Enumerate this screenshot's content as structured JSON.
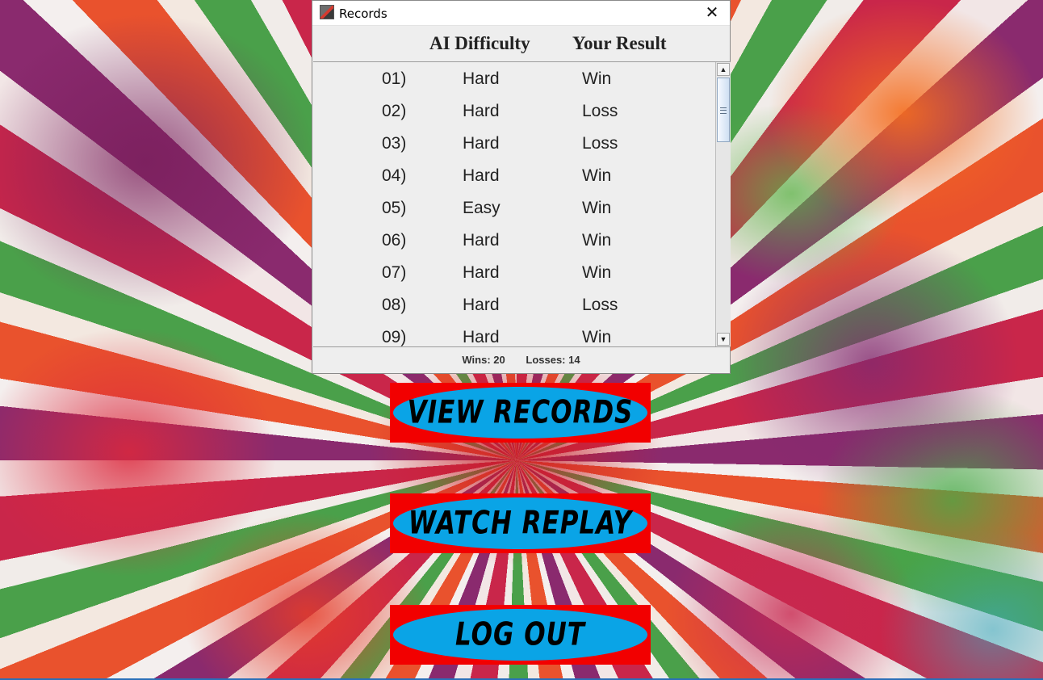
{
  "dialog": {
    "title": "Records",
    "close_glyph": "✕",
    "headers": {
      "difficulty": "AI Difficulty",
      "result": "Your Result"
    },
    "rows": [
      {
        "num": "01)",
        "difficulty": "Hard",
        "result": "Win"
      },
      {
        "num": "02)",
        "difficulty": "Hard",
        "result": "Loss"
      },
      {
        "num": "03)",
        "difficulty": "Hard",
        "result": "Loss"
      },
      {
        "num": "04)",
        "difficulty": "Hard",
        "result": "Win"
      },
      {
        "num": "05)",
        "difficulty": "Easy",
        "result": "Win"
      },
      {
        "num": "06)",
        "difficulty": "Hard",
        "result": "Win"
      },
      {
        "num": "07)",
        "difficulty": "Hard",
        "result": "Win"
      },
      {
        "num": "08)",
        "difficulty": "Hard",
        "result": "Loss"
      },
      {
        "num": "09)",
        "difficulty": "Hard",
        "result": "Win"
      }
    ],
    "footer": {
      "wins": "Wins: 20",
      "losses": "Losses: 14"
    },
    "scroll": {
      "up_glyph": "▲",
      "down_glyph": "▼"
    }
  },
  "menu": {
    "view_records": "VIEW RECORDS",
    "watch_replay": "WATCH REPLAY",
    "log_out": "LOG OUT"
  },
  "colors": {
    "button_border": "#f20000",
    "button_fill": "#0aa4e6"
  },
  "icons": {
    "app": "java-app-icon",
    "close": "close-icon"
  }
}
